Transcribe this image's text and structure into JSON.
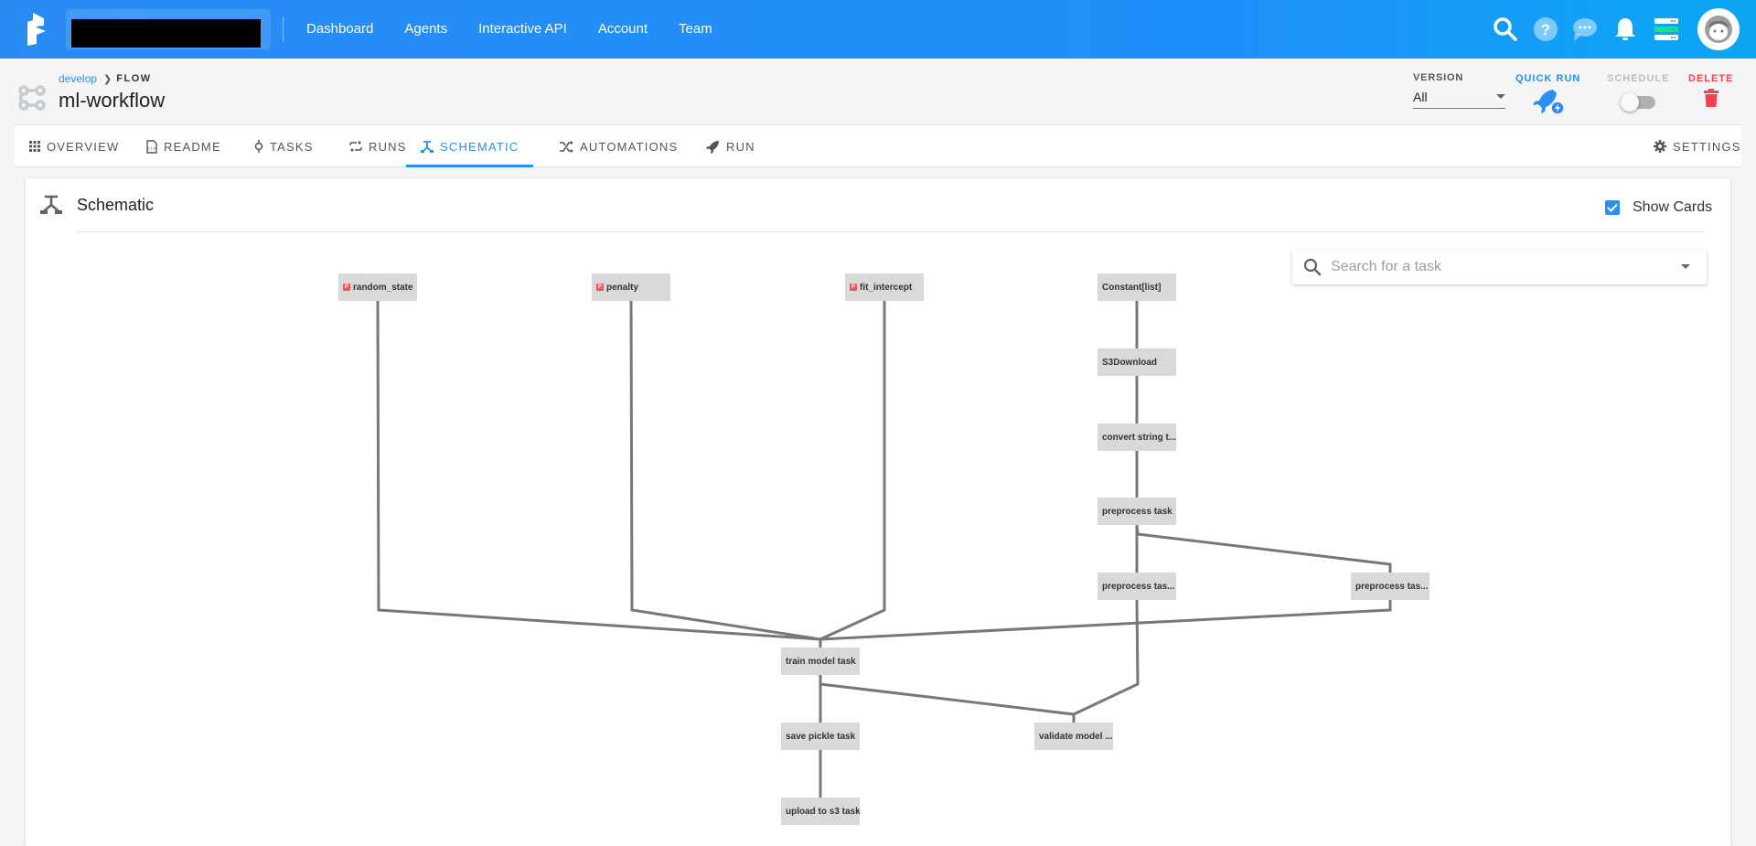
{
  "appbar": {
    "nav": [
      "Dashboard",
      "Agents",
      "Interactive API",
      "Account",
      "Team"
    ],
    "icons": [
      "search-icon",
      "help-icon",
      "chat-icon",
      "bell-icon",
      "server-icon",
      "avatar"
    ],
    "brand_color": "#2a8bf5"
  },
  "header": {
    "breadcrumb_link": "develop",
    "breadcrumb_current": "FLOW",
    "title": "ml-workflow",
    "version_label": "VERSION",
    "version_value": "All",
    "quick_run_label": "QUICK RUN",
    "schedule_label": "SCHEDULE",
    "schedule_on": false,
    "delete_label": "DELETE"
  },
  "tabs": [
    {
      "label": "OVERVIEW",
      "icon": "grid-icon",
      "active": false
    },
    {
      "label": "README",
      "icon": "readme-icon",
      "active": false
    },
    {
      "label": "TASKS",
      "icon": "task-icon",
      "active": false
    },
    {
      "label": "RUNS",
      "icon": "runs-icon",
      "active": false
    },
    {
      "label": "SCHEMATIC",
      "icon": "schematic-icon",
      "active": true
    },
    {
      "label": "AUTOMATIONS",
      "icon": "shuffle-icon",
      "active": false
    },
    {
      "label": "RUN",
      "icon": "rocket-icon",
      "active": false
    }
  ],
  "settings_label": "SETTINGS",
  "panel": {
    "title": "Schematic",
    "show_cards_label": "Show Cards",
    "show_cards_checked": true,
    "search_placeholder": "Search for a task"
  },
  "schematic": {
    "nodes": [
      {
        "id": "random_state",
        "label": "random_state",
        "parameter": true
      },
      {
        "id": "penalty",
        "label": "penalty",
        "parameter": true
      },
      {
        "id": "fit_intercept",
        "label": "fit_intercept",
        "parameter": true
      },
      {
        "id": "constant_list",
        "label": "Constant[list]",
        "parameter": false
      },
      {
        "id": "s3download",
        "label": "S3Download",
        "parameter": false
      },
      {
        "id": "convert",
        "label": "convert string t...",
        "parameter": false
      },
      {
        "id": "preprocess",
        "label": "preprocess task",
        "parameter": false
      },
      {
        "id": "preprocess2",
        "label": "preprocess tas...",
        "parameter": false
      },
      {
        "id": "preprocess3",
        "label": "preprocess tas...",
        "parameter": false
      },
      {
        "id": "train",
        "label": "train model task",
        "parameter": false
      },
      {
        "id": "save_pickle",
        "label": "save pickle task",
        "parameter": false
      },
      {
        "id": "validate",
        "label": "validate model ...",
        "parameter": false
      },
      {
        "id": "upload",
        "label": "upload to s3 task",
        "parameter": false
      }
    ],
    "edges": [
      [
        "constant_list",
        "s3download"
      ],
      [
        "s3download",
        "convert"
      ],
      [
        "convert",
        "preprocess"
      ],
      [
        "preprocess",
        "preprocess2"
      ],
      [
        "preprocess",
        "preprocess3"
      ],
      [
        "random_state",
        "train"
      ],
      [
        "penalty",
        "train"
      ],
      [
        "fit_intercept",
        "train"
      ],
      [
        "preprocess3",
        "train"
      ],
      [
        "train",
        "save_pickle"
      ],
      [
        "train",
        "validate"
      ],
      [
        "preprocess2",
        "validate"
      ],
      [
        "save_pickle",
        "upload"
      ]
    ]
  }
}
